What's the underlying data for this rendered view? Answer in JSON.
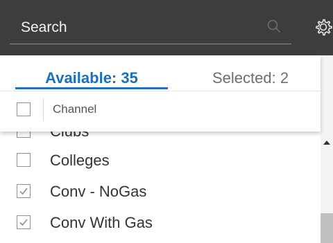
{
  "search": {
    "placeholder": "Search",
    "value": ""
  },
  "tabs": {
    "available_label": "Available: 35",
    "selected_label": "Selected: 2"
  },
  "table": {
    "column_header": "Channel"
  },
  "items": [
    {
      "label": "Clubs",
      "checked": false
    },
    {
      "label": "Colleges",
      "checked": false
    },
    {
      "label": "Conv - NoGas",
      "checked": true
    },
    {
      "label": "Conv With Gas",
      "checked": true
    }
  ],
  "icons": {
    "search": "search-icon",
    "settings": "gear-icon",
    "checkbox_checked": "checkmark-icon",
    "scroll_up": "triangle-up-icon"
  },
  "colors": {
    "topbar": "#3d3d3d",
    "accent": "#1a6fbf",
    "scroll_thumb": "#c1c1c1"
  }
}
